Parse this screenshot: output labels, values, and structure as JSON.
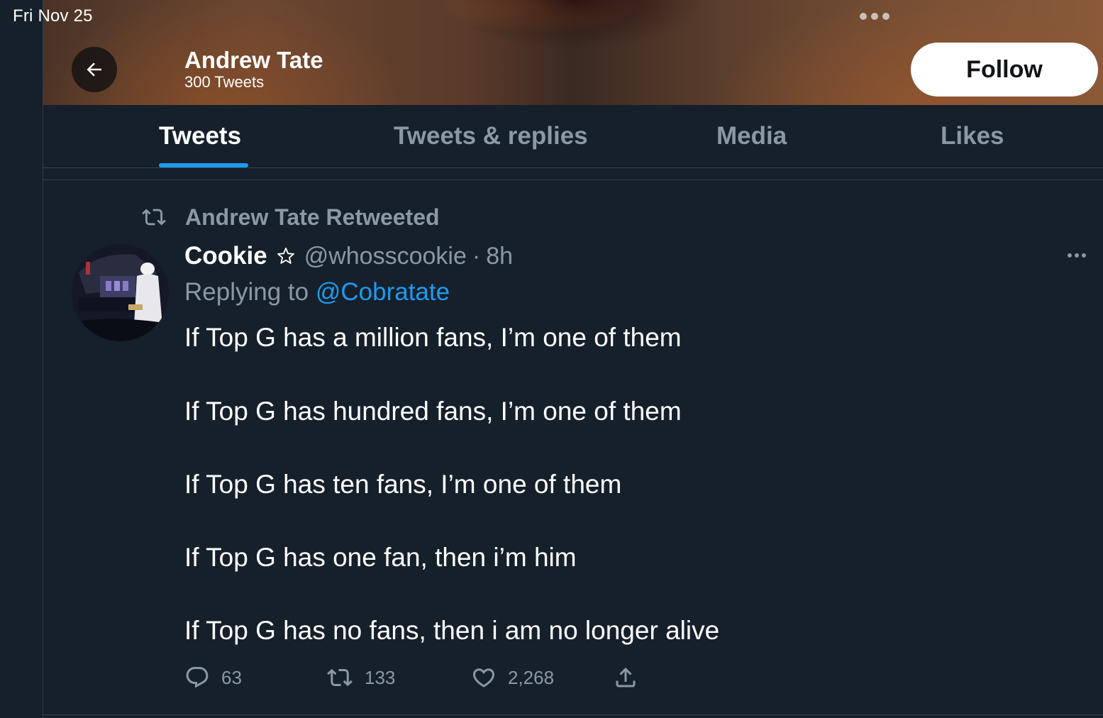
{
  "status_bar": {
    "date": "Fri Nov 25"
  },
  "header": {
    "name": "Andrew Tate",
    "tweet_count": "300 Tweets",
    "follow_label": "Follow",
    "back_icon": "arrow-left-icon"
  },
  "tabs": [
    {
      "label": "Tweets",
      "active": true
    },
    {
      "label": "Tweets & replies",
      "active": false
    },
    {
      "label": "Media",
      "active": false
    },
    {
      "label": "Likes",
      "active": false
    }
  ],
  "tweet": {
    "retweet_context": "Andrew Tate Retweeted",
    "author_name": "Cookie",
    "author_badge_icon": "star-outline-icon",
    "author_handle": "@whosscookie",
    "separator": "·",
    "time": "8h",
    "replying_to_prefix": "Replying to",
    "replying_to_handle": "@Cobratate",
    "lines": [
      "If Top G has a million fans, I’m one of them",
      "If Top G has hundred fans, I’m one of them",
      "If Top G has ten fans, I’m one of them",
      "If Top G has one fan, then i’m him",
      "If Top G has no fans, then i am no longer alive"
    ],
    "actions": {
      "replies": "63",
      "retweets": "133",
      "likes": "2,268"
    }
  },
  "colors": {
    "background": "#15202b",
    "accent": "#1d9bf0",
    "secondary_text": "#8b98a5"
  }
}
